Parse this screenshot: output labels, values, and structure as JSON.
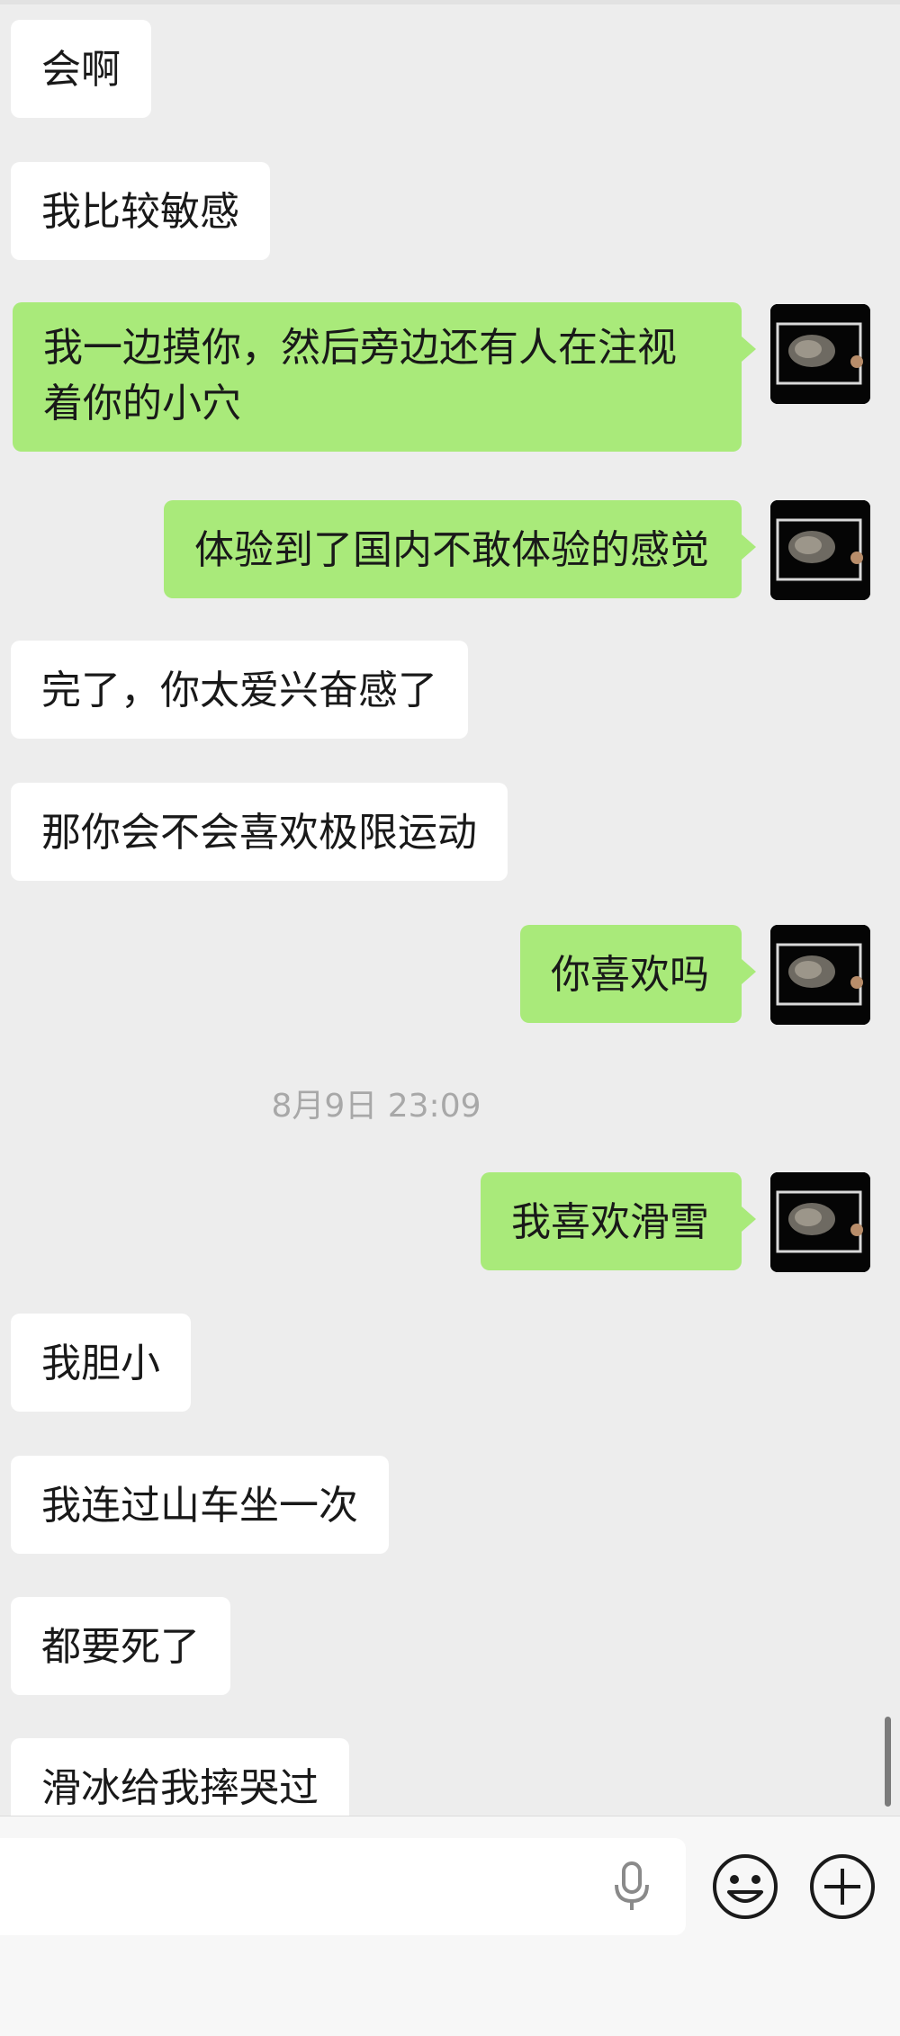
{
  "messages": [
    {
      "side": "in",
      "text": "会啊"
    },
    {
      "side": "in",
      "text": "我比较敏感"
    },
    {
      "side": "out",
      "text": "我一边摸你，然后旁边还有人在注视着你的小穴"
    },
    {
      "side": "out",
      "text": "体验到了国内不敢体验的感觉"
    },
    {
      "side": "in",
      "text": "完了，你太爱兴奋感了"
    },
    {
      "side": "in",
      "text": "那你会不会喜欢极限运动"
    },
    {
      "side": "out",
      "text": "你喜欢吗"
    },
    {
      "side": "time",
      "text": "8月9日 23:09"
    },
    {
      "side": "out",
      "text": "我喜欢滑雪"
    },
    {
      "side": "in",
      "text": "我胆小"
    },
    {
      "side": "in",
      "text": "我连过山车坐一次"
    },
    {
      "side": "in",
      "text": "都要死了"
    },
    {
      "side": "in",
      "text": "滑冰给我摔哭过"
    }
  ],
  "input_bar": {
    "placeholder": "",
    "icons": [
      "microphone-icon",
      "emoji-icon",
      "plus-icon"
    ]
  },
  "colors": {
    "background": "#ededed",
    "incoming_bubble": "#ffffff",
    "outgoing_bubble": "#a9ea7a",
    "timestamp": "#a8a8a8"
  }
}
